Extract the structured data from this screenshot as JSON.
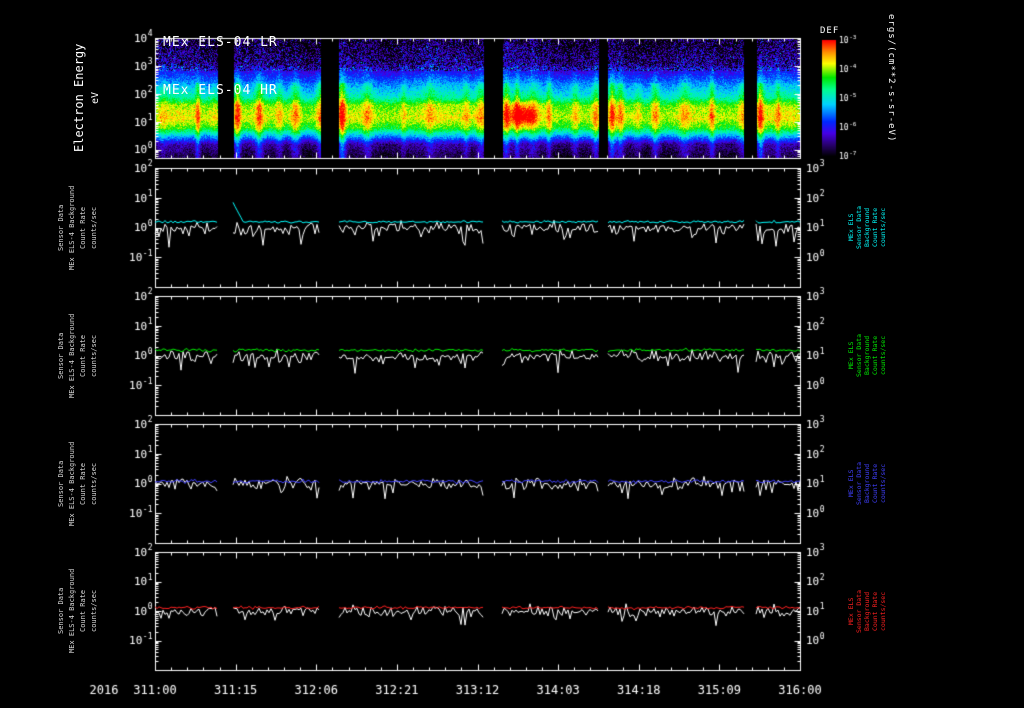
{
  "app": {
    "background": "#000000",
    "foreground": "#ffffff"
  },
  "header": {
    "title_lines": [
      "MEx ELS-04 LR",
      "MEx ELS-04 HR"
    ]
  },
  "time_axis": {
    "year": "2016",
    "tick_labels": [
      "311:00",
      "311:15",
      "312:06",
      "312:21",
      "313:12",
      "314:03",
      "314:18",
      "315:09",
      "316:00"
    ]
  },
  "chart_data": [
    {
      "type": "heatmap",
      "name": "electron-energy-spectrogram",
      "title": "MEx ELS-04 LR / MEx ELS-04 HR",
      "ylabel": "Electron Energy",
      "ylabel_units": "eV",
      "y_tick_exps": [
        4,
        3,
        2,
        1,
        0
      ],
      "ylim_log10": [
        -0.3,
        4.0
      ],
      "x_range": [
        "2016 311:00",
        "2016 316:00"
      ],
      "colorbar": {
        "title": "DEF",
        "units": "ergs/(cm**2-s-sr-eV)",
        "tick_exps": [
          -3,
          -4,
          -5,
          -6,
          -7
        ],
        "range_log10": [
          -7,
          -3
        ]
      },
      "data_gaps_frac": [
        [
          0.097,
          0.121
        ],
        [
          0.256,
          0.285
        ],
        [
          0.51,
          0.538
        ],
        [
          0.687,
          0.702
        ],
        [
          0.913,
          0.932
        ]
      ],
      "flux_profile_log10": [
        [
          -0.3,
          -6.9
        ],
        [
          0.2,
          -6.5
        ],
        [
          0.55,
          -5.2
        ],
        [
          0.8,
          -4.3
        ],
        [
          1.15,
          -3.85
        ],
        [
          1.6,
          -4.1
        ],
        [
          1.9,
          -4.9
        ],
        [
          2.3,
          -5.35
        ],
        [
          2.7,
          -5.9
        ],
        [
          3.1,
          -6.5
        ],
        [
          4.0,
          -6.9
        ]
      ],
      "hot_spot": {
        "x_frac": [
          0.538,
          0.6
        ],
        "log_energy": [
          0.8,
          1.7
        ],
        "boost_log10": 1.0
      }
    },
    {
      "type": "line",
      "name": "els-count-rate-panel-1",
      "accent": "#00ffff",
      "left_tick_exps": [
        2,
        1,
        0,
        -1
      ],
      "right_tick_exps": [
        3,
        2,
        1,
        0
      ],
      "ylim_log10": [
        -2,
        2
      ],
      "left_label_lines": [
        "Sensor Data",
        "MEx ELS-4 Background",
        "Count Rate",
        "counts/sec"
      ],
      "right_label_lines": [
        "MEx ELS",
        "Sensor Data",
        "Background",
        "Count Rate",
        "counts/sec"
      ],
      "series": [
        {
          "name": "count-rate",
          "color": "#ffffff",
          "baseline": 0.92,
          "noise_dec": 0.1,
          "dip_prob": 0.07,
          "dip_depth": 0.5
        },
        {
          "name": "background",
          "color": "#00ffff",
          "baseline": 1.55,
          "noise_dec": 0.02,
          "start_spike": {
            "segment": 1,
            "value": 7.0
          }
        }
      ]
    },
    {
      "type": "line",
      "name": "els-count-rate-panel-2",
      "accent": "#00ee00",
      "left_tick_exps": [
        2,
        1,
        0,
        -1
      ],
      "right_tick_exps": [
        3,
        2,
        1,
        0
      ],
      "ylim_log10": [
        -2,
        2
      ],
      "left_label_lines": [
        "Sensor Data",
        "MEx ELS-4 Background",
        "Count Rate",
        "counts/sec"
      ],
      "right_label_lines": [
        "MEx ELS",
        "Sensor Data",
        "Background",
        "Count Rate",
        "counts/sec"
      ],
      "series": [
        {
          "name": "count-rate",
          "color": "#ffffff",
          "baseline": 0.92,
          "noise_dec": 0.1,
          "dip_prob": 0.05,
          "dip_depth": 0.4
        },
        {
          "name": "background",
          "color": "#00ee00",
          "baseline": 1.5,
          "noise_dec": 0.025
        }
      ]
    },
    {
      "type": "line",
      "name": "els-count-rate-panel-3",
      "accent": "#4040ff",
      "left_tick_exps": [
        2,
        1,
        0,
        -1
      ],
      "right_tick_exps": [
        3,
        2,
        1,
        0
      ],
      "ylim_log10": [
        -2,
        2
      ],
      "left_label_lines": [
        "Sensor Data",
        "MEx ELS-4 Background",
        "Count Rate",
        "counts/sec"
      ],
      "right_label_lines": [
        "MEx ELS",
        "Sensor Data",
        "Background",
        "Count Rate",
        "counts/sec"
      ],
      "series": [
        {
          "name": "count-rate",
          "color": "#ffffff",
          "baseline": 0.95,
          "noise_dec": 0.1,
          "dip_prob": 0.05,
          "dip_depth": 0.4
        },
        {
          "name": "background",
          "color": "#4040ff",
          "baseline": 1.18,
          "noise_dec": 0.03
        }
      ]
    },
    {
      "type": "line",
      "name": "els-count-rate-panel-4",
      "accent": "#ff2020",
      "left_tick_exps": [
        2,
        1,
        0,
        -1
      ],
      "right_tick_exps": [
        3,
        2,
        1,
        0
      ],
      "ylim_log10": [
        -2,
        2
      ],
      "left_label_lines": [
        "Sensor Data",
        "MEx ELS-4 Background",
        "Count Rate",
        "counts/sec"
      ],
      "right_label_lines": [
        "MEx ELS",
        "Sensor Data",
        "Background",
        "Count Rate",
        "counts/sec"
      ],
      "series": [
        {
          "name": "count-rate",
          "color": "#ffffff",
          "baseline": 0.95,
          "noise_dec": 0.09,
          "dip_prob": 0.04,
          "dip_depth": 0.35
        },
        {
          "name": "background",
          "color": "#ff2020",
          "baseline": 1.3,
          "noise_dec": 0.025
        }
      ]
    }
  ]
}
